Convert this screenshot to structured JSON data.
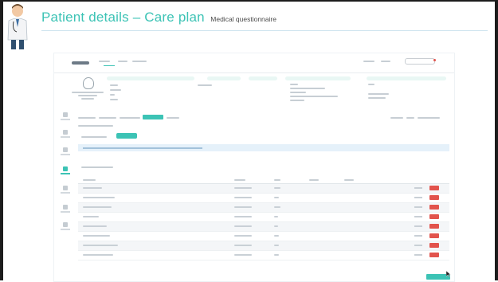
{
  "slide": {
    "title": "Patient details – Care plan",
    "subtitle": "Medical questionnaire",
    "accent_color": "#3cc3b5"
  },
  "app": {
    "care_plan_tab": {
      "active": true
    },
    "confirm_button": {
      "visible": true
    }
  },
  "icons": {
    "doctor": "doctor-illustration-icon",
    "avatar": "user-avatar-icon",
    "cursor": "mouse-pointer-icon"
  }
}
